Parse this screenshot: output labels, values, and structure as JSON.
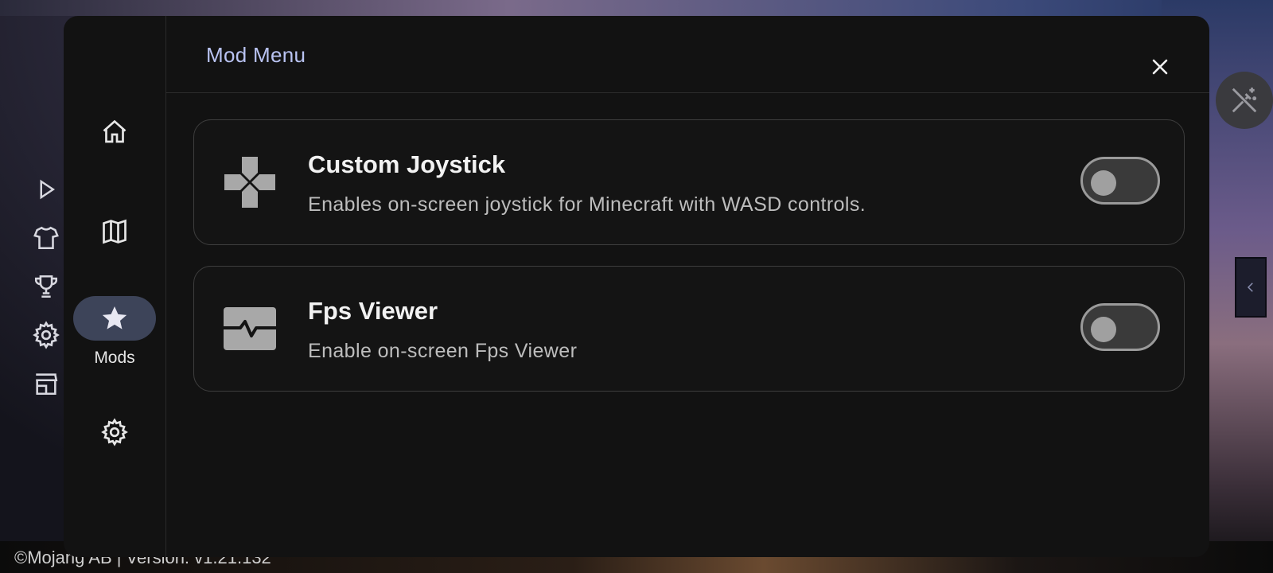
{
  "app": {
    "footer_text": "©Mojang AB | Version: v1.21.132"
  },
  "dialog": {
    "title": "Mod Menu",
    "close_icon": "close-icon"
  },
  "nav": {
    "items": [
      {
        "icon": "home-icon",
        "label": ""
      },
      {
        "icon": "map-icon",
        "label": ""
      },
      {
        "icon": "star-icon",
        "label": "Mods",
        "active": true
      },
      {
        "icon": "gear-icon",
        "label": ""
      }
    ]
  },
  "mods": [
    {
      "title": "Custom Joystick",
      "description": "Enables on-screen joystick for Minecraft with WASD controls.",
      "icon": "dpad-icon",
      "enabled": false
    },
    {
      "title": "Fps Viewer",
      "description": "Enable on-screen Fps Viewer",
      "icon": "monitor-heart-icon",
      "enabled": false
    }
  ],
  "colors": {
    "accent": "#b9c3f2",
    "nav_active_bg": "#3d4459",
    "dialog_bg": "#121212"
  }
}
